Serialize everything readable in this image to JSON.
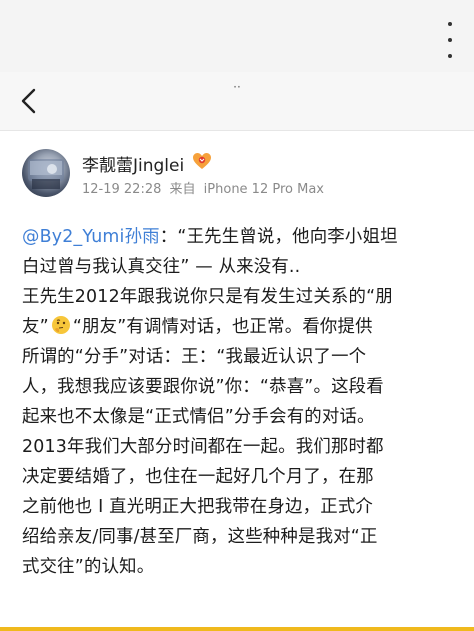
{
  "nav": {
    "title": "··"
  },
  "post": {
    "username": "李靓蕾Jinglei",
    "time": "12-19 22:28",
    "source_prefix": "来自",
    "device": "iPhone 12 Pro Max",
    "lines": [
      {
        "mention": "@By2_Yumi孙雨",
        "text": "：“王先生曾说，他向李小姐坦"
      },
      {
        "text": "白过曾与我认真交往” — 从来没有.."
      },
      {
        "text": "王先生2012年跟我说你只是有发生过关系的“朋"
      },
      {
        "text_before": "友”",
        "text_after": "“朋友”有调情对话，也正常。看你提供"
      },
      {
        "text": "所谓的“分手”对话：王：“我最近认识了一个"
      },
      {
        "text": "人，我想我应该要跟你说”你：“恭喜”。这段看"
      },
      {
        "text": "起来也不太像是“正式情侣”分手会有的对话。"
      },
      {
        "text": "2013年我们大部分时间都在一起。我们那时都"
      },
      {
        "text": "决定要结婚了，也住在一起好几个月了，在那"
      },
      {
        "text": "之前他也 I 直光明正大把我带在身边，正式介"
      },
      {
        "text": "绍给亲友/同事/甚至厂商，这些种种是我对“正"
      },
      {
        "text": "式交往”的认知。"
      }
    ]
  },
  "colors": {
    "mention": "#3f7fd6",
    "accent_bar": "#f0b91c"
  },
  "icons": {
    "more": "more-vertical-icon",
    "back": "back-chevron-icon",
    "badge": "vip-badge-icon",
    "emoji": "thinking-face-emoji"
  }
}
